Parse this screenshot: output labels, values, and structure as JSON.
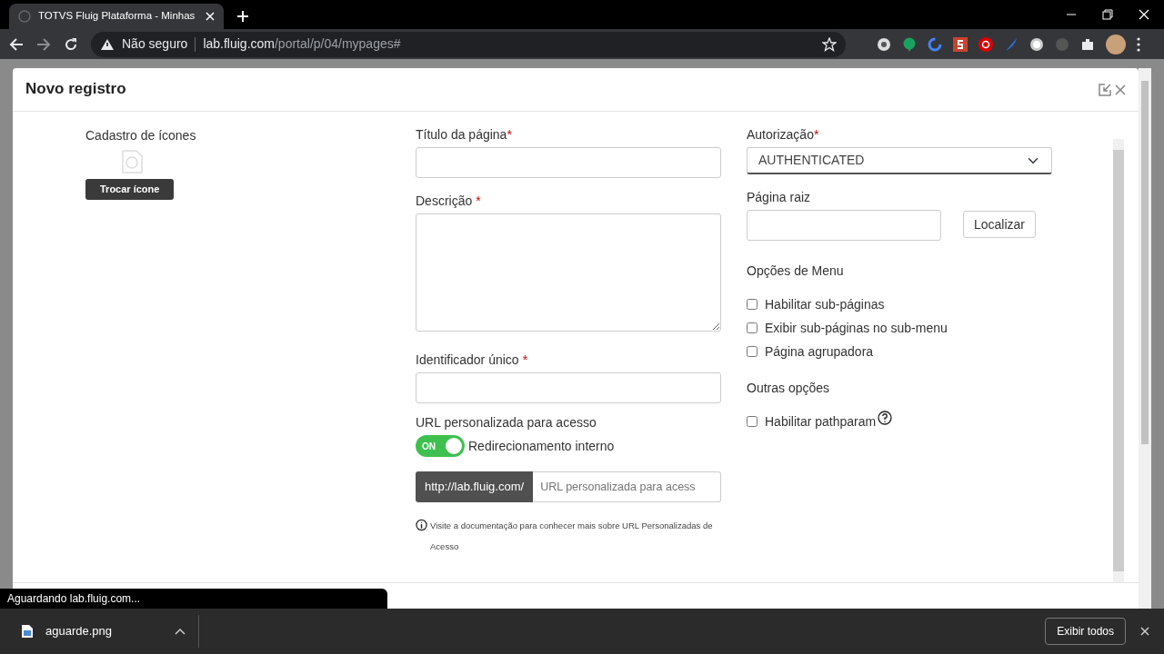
{
  "browser": {
    "tab_title": "TOTVS Fluig Plataforma - Minhas",
    "security": "Não seguro",
    "url_host": "lab.fluig.com",
    "url_path": "/portal/p/04/mypages#"
  },
  "modal": {
    "title": "Novo registro",
    "icon_panel": {
      "label": "Cadastro de ícones",
      "button": "Trocar ícone"
    },
    "middle_fields": [
      {
        "kind": "input",
        "label": "Título da página",
        "required_mark": "*",
        "mark_spaced": false
      },
      {
        "kind": "textarea",
        "label": "Descrição",
        "required_mark": "*",
        "mark_spaced": true
      },
      {
        "kind": "input",
        "label": "Identificador único",
        "required_mark": "*",
        "mark_spaced": true
      }
    ],
    "custom_url": {
      "label": "URL personalizada para acesso",
      "toggle": {
        "label": "ON",
        "on": true
      },
      "toggle_text": "Redirecionamento interno",
      "prefix": "http://lab.fluig.com/",
      "placeholder": "URL personalizada para acess",
      "note": "Visite a documentação para conhecer mais sobre URL Personalizadas de Acesso"
    },
    "authorization": {
      "label": "Autorização",
      "required_mark": "*",
      "value": "AUTHENTICATED"
    },
    "root_page": {
      "label": "Página raiz",
      "button": "Localizar"
    },
    "menu_options": {
      "heading": "Opções de Menu",
      "items": [
        {
          "label": "Habilitar sub-páginas",
          "checked": false
        },
        {
          "label": "Exibir sub-páginas no sub-menu",
          "checked": false
        },
        {
          "label": "Página agrupadora",
          "checked": false
        }
      ]
    },
    "other_options": {
      "heading": "Outras opções",
      "items": [
        {
          "label": "Habilitar pathparam",
          "checked": false,
          "help": true
        }
      ]
    }
  },
  "status_text": "Aguardando lab.fluig.com...",
  "download_bar": {
    "file": "aguarde.png",
    "button": "Exibir todos"
  }
}
